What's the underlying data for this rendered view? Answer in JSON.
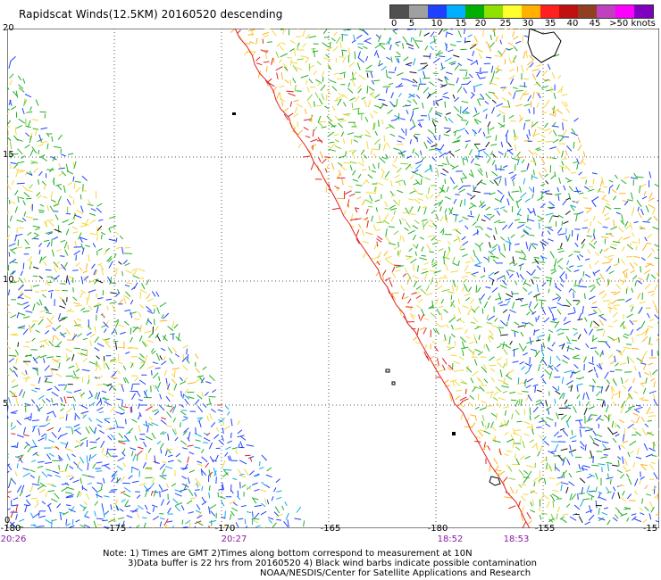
{
  "title": "Rapidscat Winds(12.5KM) 20160520 descending",
  "legend": {
    "labels": [
      "0",
      "5",
      "10",
      "15",
      "20",
      "25",
      "30",
      "35",
      "40",
      "45",
      ">50 knots"
    ],
    "colors": [
      "#505050",
      "#a0a0a0",
      "#1e40ff",
      "#00b0ff",
      "#00b000",
      "#90e000",
      "#ffff30",
      "#ffb000",
      "#ff2020",
      "#c01010",
      "#904020",
      "#c040c0",
      "#ff00ff",
      "#8000c0"
    ]
  },
  "axes": {
    "lat_labels": [
      "20",
      "15",
      "10",
      "5",
      "0"
    ],
    "lon_labels": [
      "-180",
      "-175",
      "-170",
      "-165",
      "-180",
      "-155",
      "-15"
    ],
    "time_labels": [
      "20:26",
      "20:27",
      "18:52",
      "18:53"
    ]
  },
  "notes": [
    "Note: 1) Times are GMT 2)Times along bottom correspond to measurement at 10N",
    "3)Data buffer is 22 hrs from 20160520 4) Black wind barbs indicate possible contamination",
    "NOAA/NESDIS/Center for Satellite Applications and Research"
  ]
}
